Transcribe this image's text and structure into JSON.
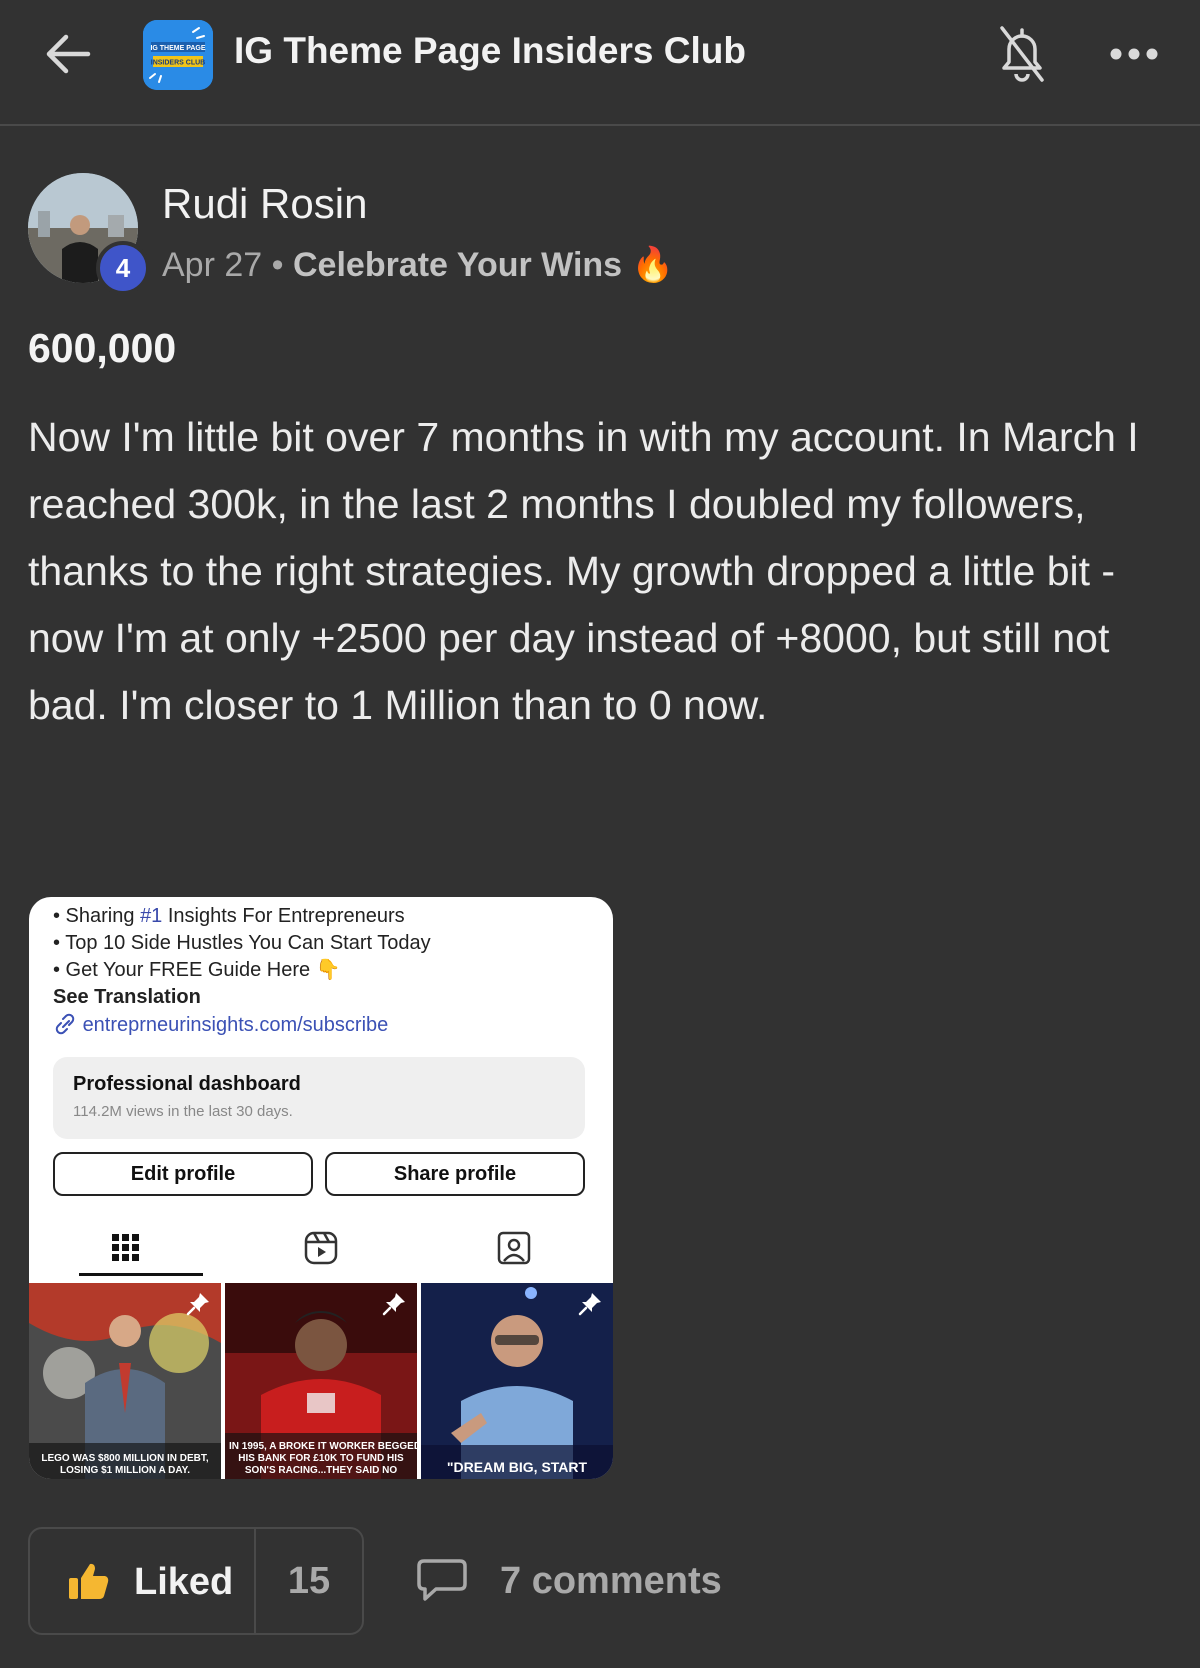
{
  "header": {
    "title": "IG Theme Page Insiders Club",
    "logo_text_top": "IG THEME PAGE",
    "logo_text_bottom": "INSIDERS CLUB",
    "back_icon": "arrow-left-icon",
    "bell_icon": "bell-off-icon",
    "more_icon": "more-horizontal-icon"
  },
  "post": {
    "author": "Rudi Rosin",
    "level": "4",
    "date": "Apr 27",
    "separator": "•",
    "category": "Celebrate Your Wins",
    "category_emoji": "🔥",
    "title": "600,000",
    "body": "Now I'm little bit over 7 months in with my account. In March I reached 300k, in the last 2 months I doubled my followers, thanks to the right strategies. My growth dropped a little bit - now I'm at only +2500 per day instead of +8000, but still not bad. I'm closer to 1 Million than to 0 now."
  },
  "attachment": {
    "bio_line1_prefix": "• Sharing ",
    "bio_line1_hash": "#1",
    "bio_line1_suffix": " Insights For Entrepreneurs",
    "bio_line2": "• Top 10 Side Hustles You Can Start Today",
    "bio_line3": "• Get Your FREE Guide Here 👇",
    "see_translation": "See Translation",
    "link": "entreprneurinsights.com/subscribe",
    "dashboard_title": "Professional dashboard",
    "dashboard_sub": "114.2M views in the last 30 days.",
    "edit_profile": "Edit profile",
    "share_profile": "Share profile",
    "thumbs": [
      {
        "caption_1": "LEGO WAS $800 MILLION IN DEBT,",
        "caption_2": "LOSING $1 MILLION A DAY."
      },
      {
        "caption_1": "IN 1995, A BROKE IT WORKER BEGGED",
        "caption_2": "HIS BANK FOR £10K TO FUND HIS",
        "caption_3": "SON'S RACING...THEY SAID NO"
      },
      {
        "caption_1": "\"DREAM BIG, START"
      }
    ]
  },
  "actions": {
    "like_label": "Liked",
    "like_count": "15",
    "comments_label": "7 comments",
    "like_icon": "thumbs-up-icon",
    "comment_icon": "comment-icon"
  },
  "colors": {
    "background": "#323232",
    "badge": "#3f55c9",
    "like_icon": "#f5b731",
    "link": "#3b51b5"
  }
}
